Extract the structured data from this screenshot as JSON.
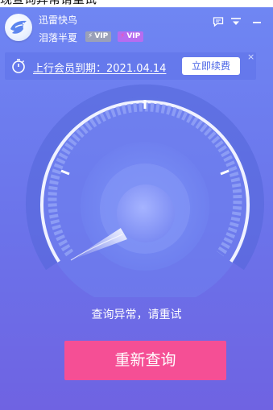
{
  "top_fragment": "现查询异常请重试",
  "header": {
    "app_name": "迅雷快鸟",
    "nickname": "泪落半夏",
    "badges": [
      {
        "text": "VIP",
        "icon": "lightning-icon",
        "color": "#9aa0b8"
      },
      {
        "text": "VIP",
        "icon": "lightning-icon",
        "color": "#b66cf0"
      }
    ],
    "controls": [
      "message-icon",
      "menu-icon",
      "minimize-icon"
    ]
  },
  "banner": {
    "expiry_text": "上行会员到期：2021.04.14",
    "renew_label": "立即续费",
    "close_glyph": "×"
  },
  "gauge": {
    "speed_value": 0
  },
  "status_text": "查询异常，请重试",
  "retry_label": "重新查询",
  "colors": {
    "accent_pink": "#f54f95",
    "background": "#6b73ea",
    "renew_text": "#4a64e6"
  }
}
